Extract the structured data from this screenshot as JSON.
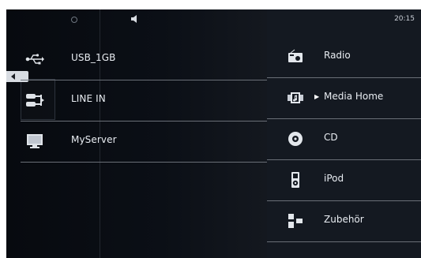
{
  "status": {
    "time": "20:15"
  },
  "sources": [
    {
      "label": "USB_1GB",
      "icon": "usb-icon"
    },
    {
      "label": "LINE IN",
      "icon": "line-in-icon"
    },
    {
      "label": "MyServer",
      "icon": "server-icon"
    }
  ],
  "menu": [
    {
      "label": "Radio",
      "icon": "radio-icon"
    },
    {
      "label": "Media Home",
      "icon": "media-home-icon",
      "selected": true
    },
    {
      "label": "CD",
      "icon": "cd-icon"
    },
    {
      "label": "iPod",
      "icon": "ipod-icon"
    },
    {
      "label": "Zubehör",
      "icon": "accessories-icon"
    }
  ]
}
